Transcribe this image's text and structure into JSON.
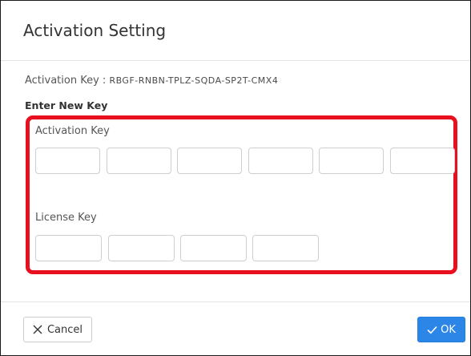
{
  "dialog": {
    "title": "Activation Setting",
    "current_key_label": "Activation Key : ",
    "current_key_value": "RBGF-RNBN-TPLZ-SQDA-SP2T-CMX4",
    "enter_new_key_label": "Enter New Key",
    "activation_key": {
      "label": "Activation Key",
      "segments": [
        "",
        "",
        "",
        "",
        "",
        ""
      ]
    },
    "license_key": {
      "label": "License Key",
      "segments": [
        "",
        "",
        "",
        ""
      ]
    }
  },
  "footer": {
    "cancel_label": "Cancel",
    "ok_label": "OK"
  },
  "colors": {
    "highlight": "#e8101f",
    "primary": "#2b86e8"
  },
  "icons": {
    "cancel": "close-icon",
    "ok": "check-icon"
  }
}
